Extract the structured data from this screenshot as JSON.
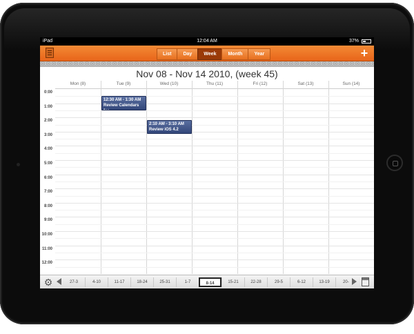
{
  "status_bar": {
    "carrier": "iPad",
    "time": "12:04 AM",
    "battery": "37%"
  },
  "toolbar": {
    "views": [
      "List",
      "Day",
      "Week",
      "Month",
      "Year"
    ],
    "active_view": "Week",
    "add_label": "+"
  },
  "calendar": {
    "title": "Nov 08 - Nov 14 2010, (week 45)",
    "days": [
      "Mon (8)",
      "Tue (9)",
      "Wed (10)",
      "Thu (11)",
      "Fri (12)",
      "Sat (13)",
      "Sun (14)"
    ],
    "hours": [
      "0:00",
      "1:00",
      "2:00",
      "3:00",
      "4:00",
      "5:00",
      "6:00",
      "7:00",
      "8:00",
      "9:00",
      "10:00",
      "11:00",
      "12:00"
    ],
    "events": [
      {
        "day": 1,
        "start_hour": 0.5,
        "end_hour": 1.5,
        "time": "12:30 AM - 1:30 AM",
        "title": "Review Calendars for"
      },
      {
        "day": 2,
        "start_hour": 2.17,
        "end_hour": 3.17,
        "time": "2:10 AM - 3:10 AM",
        "title": "Review iOS 4.2"
      }
    ]
  },
  "week_strip": {
    "weeks": [
      "27-3",
      "4-10",
      "11-17",
      "18-24",
      "25-31",
      "1-7",
      "8-14",
      "15-21",
      "22-28",
      "29-5",
      "6-12",
      "13-19",
      "20-2"
    ],
    "selected": "8-14"
  },
  "colors": {
    "toolbar_orange": "#e8701f",
    "event_blue": "#3b4f82"
  }
}
